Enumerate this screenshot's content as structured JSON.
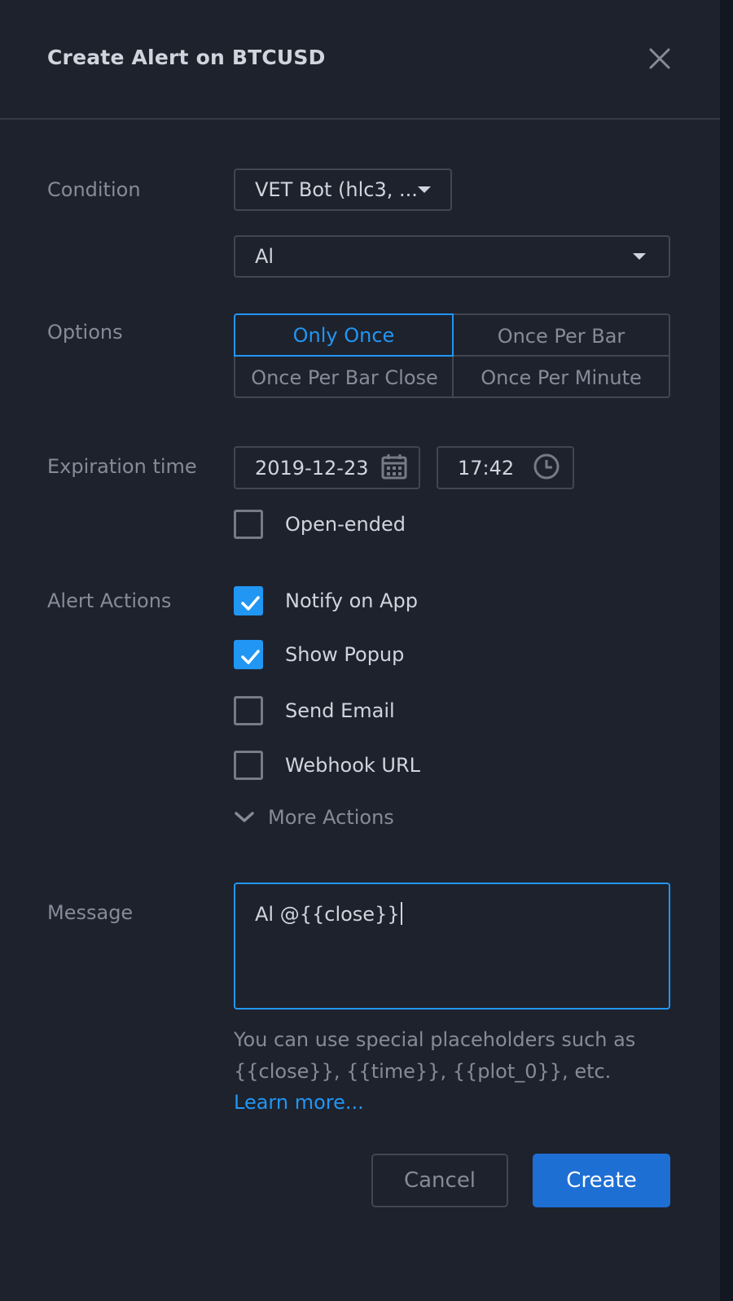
{
  "dialog": {
    "title": "Create Alert on BTCUSD",
    "close_icon": "close-icon"
  },
  "condition": {
    "label": "Condition",
    "indicator": "VET Bot (hlc3, ...",
    "signal": "Al"
  },
  "options": {
    "label": "Options",
    "items": [
      "Only Once",
      "Once Per Bar",
      "Once Per Bar Close",
      "Once Per Minute"
    ],
    "selected": "Only Once"
  },
  "expiration": {
    "label": "Expiration time",
    "date": "2019-12-23",
    "time": "17:42",
    "date_icon": "calendar-icon",
    "time_icon": "clock-icon",
    "open_ended_label": "Open-ended",
    "open_ended_checked": false
  },
  "alert_actions": {
    "label": "Alert Actions",
    "items": [
      {
        "label": "Notify on App",
        "checked": true
      },
      {
        "label": "Show Popup",
        "checked": true
      },
      {
        "label": "Send Email",
        "checked": false
      },
      {
        "label": "Webhook URL",
        "checked": false
      }
    ],
    "more_label": "More Actions"
  },
  "message": {
    "label": "Message",
    "value": "Al @{{close}}",
    "hint_line1": "You can use special placeholders such as",
    "hint_line2": "{{close}}, {{time}}, {{plot_0}}, etc.",
    "learn_more": "Learn more..."
  },
  "buttons": {
    "cancel": "Cancel",
    "create": "Create"
  },
  "colors": {
    "background": "#1e222d",
    "accent": "#2196f3",
    "primary_button": "#1e6fd4",
    "border": "#434651",
    "muted_text": "#868b98"
  }
}
